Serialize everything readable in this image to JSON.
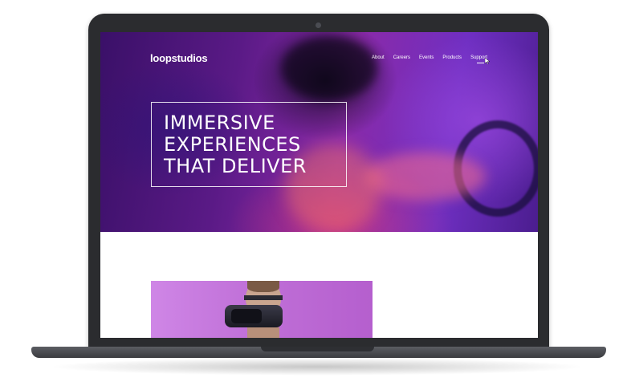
{
  "site": {
    "logo": "loopstudios",
    "nav": [
      {
        "label": "About"
      },
      {
        "label": "Careers"
      },
      {
        "label": "Events"
      },
      {
        "label": "Products"
      },
      {
        "label": "Support"
      }
    ],
    "hero": {
      "headline_lines": [
        "IMMERSIVE",
        "EXPERIENCES",
        "THAT DELIVER"
      ]
    }
  },
  "colors": {
    "hero_purple": "#6f2fc2",
    "hero_magenta": "#e63c6e",
    "image_violet": "#c070d8",
    "laptop_body": "#2b2c2f",
    "text": "#ffffff"
  },
  "icons": {
    "cursor": "mouse-pointer-icon",
    "camera": "camera-icon"
  }
}
